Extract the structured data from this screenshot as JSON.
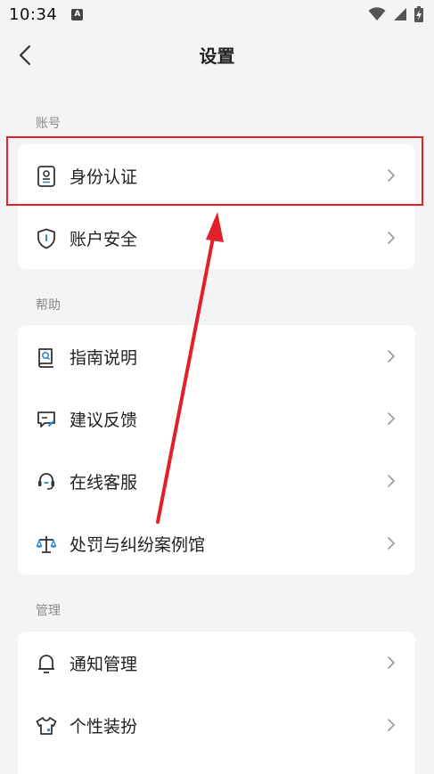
{
  "status_bar": {
    "time": "10:34",
    "notification_icon": "a-notification-icon",
    "icons": [
      "wifi-icon",
      "signal-icon",
      "battery-charging-icon"
    ]
  },
  "header": {
    "title": "设置",
    "back_icon": "back-arrow-icon"
  },
  "sections": {
    "account": {
      "label": "账号",
      "items": [
        {
          "label": "身份认证",
          "icon": "id-card-icon"
        },
        {
          "label": "账户安全",
          "icon": "shield-icon"
        }
      ]
    },
    "help": {
      "label": "帮助",
      "items": [
        {
          "label": "指南说明",
          "icon": "book-search-icon"
        },
        {
          "label": "建议反馈",
          "icon": "feedback-icon"
        },
        {
          "label": "在线客服",
          "icon": "headset-icon"
        },
        {
          "label": "处罚与纠纷案例馆",
          "icon": "scales-icon"
        }
      ]
    },
    "manage": {
      "label": "管理",
      "items": [
        {
          "label": "通知管理",
          "icon": "bell-icon"
        },
        {
          "label": "个性装扮",
          "icon": "tshirt-icon"
        }
      ]
    }
  },
  "annotation": {
    "highlight_color": "#e0212a",
    "highlighted_item": "身份认证"
  }
}
